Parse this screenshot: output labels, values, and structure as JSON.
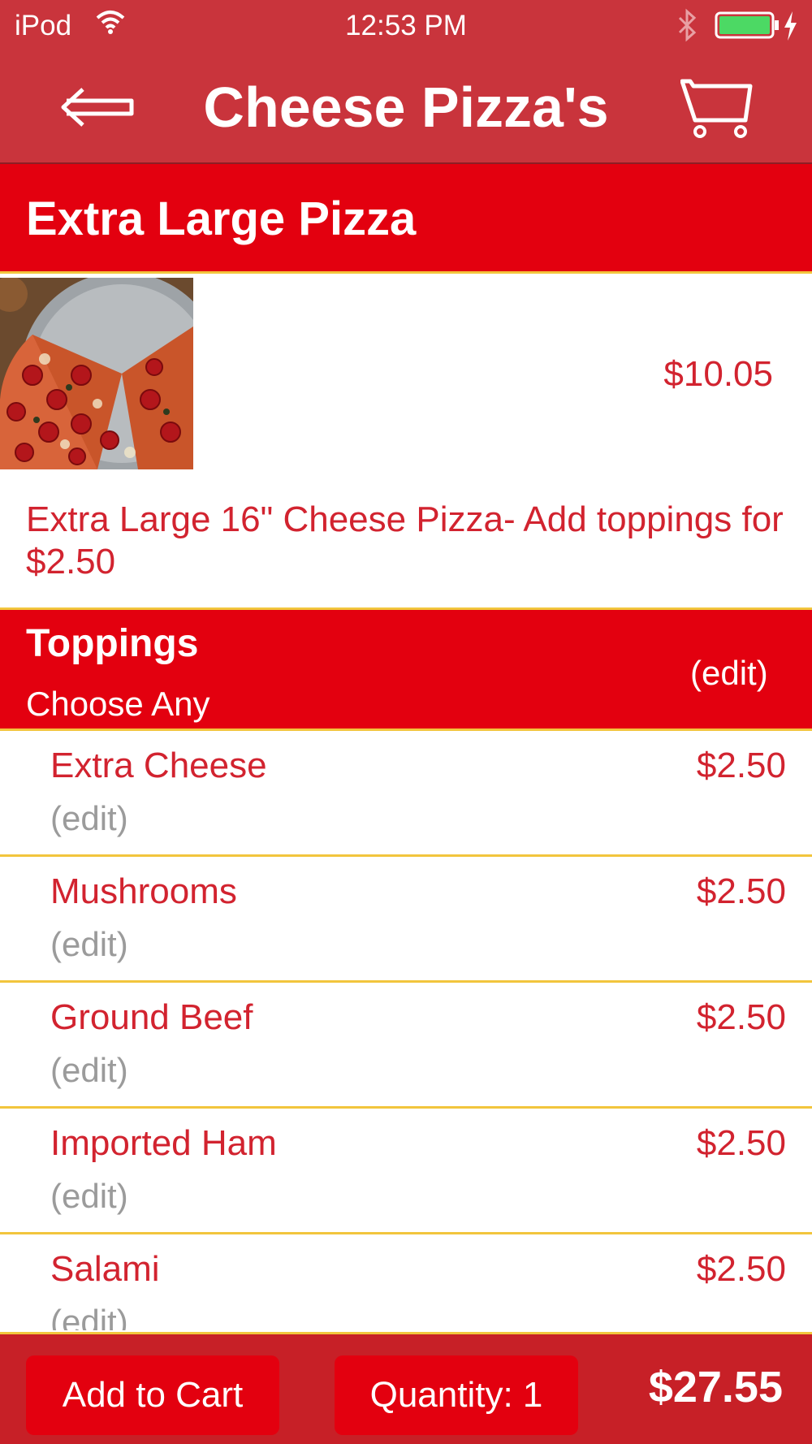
{
  "status_bar": {
    "carrier": "iPod",
    "time": "12:53 PM",
    "battery_color": "#4cd964"
  },
  "nav": {
    "title": "Cheese Pizza's",
    "back_icon": "back-arrow-icon",
    "cart_icon": "cart-icon"
  },
  "item": {
    "title": "Extra Large Pizza",
    "price": "$10.05",
    "description": "Extra Large 16\" Cheese Pizza- Add toppings for $2.50"
  },
  "toppings_group": {
    "title": "Toppings",
    "subtitle": "Choose Any",
    "edit_label": "(edit)"
  },
  "toppings": [
    {
      "name": "Extra Cheese",
      "price": "$2.50",
      "edit": "(edit)"
    },
    {
      "name": "Mushrooms",
      "price": "$2.50",
      "edit": "(edit)"
    },
    {
      "name": "Ground Beef",
      "price": "$2.50",
      "edit": "(edit)"
    },
    {
      "name": "Imported Ham",
      "price": "$2.50",
      "edit": "(edit)"
    },
    {
      "name": "Salami",
      "price": "$2.50",
      "edit": "(edit)"
    }
  ],
  "footer": {
    "add_to_cart": "Add to Cart",
    "quantity": "Quantity: 1",
    "total": "$27.55"
  },
  "colors": {
    "bar_red": "#c9343c",
    "header_red": "#e3000f",
    "text_red": "#d2232f",
    "divider_yellow": "#f2c53d",
    "edit_gray": "#9b9b9b"
  }
}
